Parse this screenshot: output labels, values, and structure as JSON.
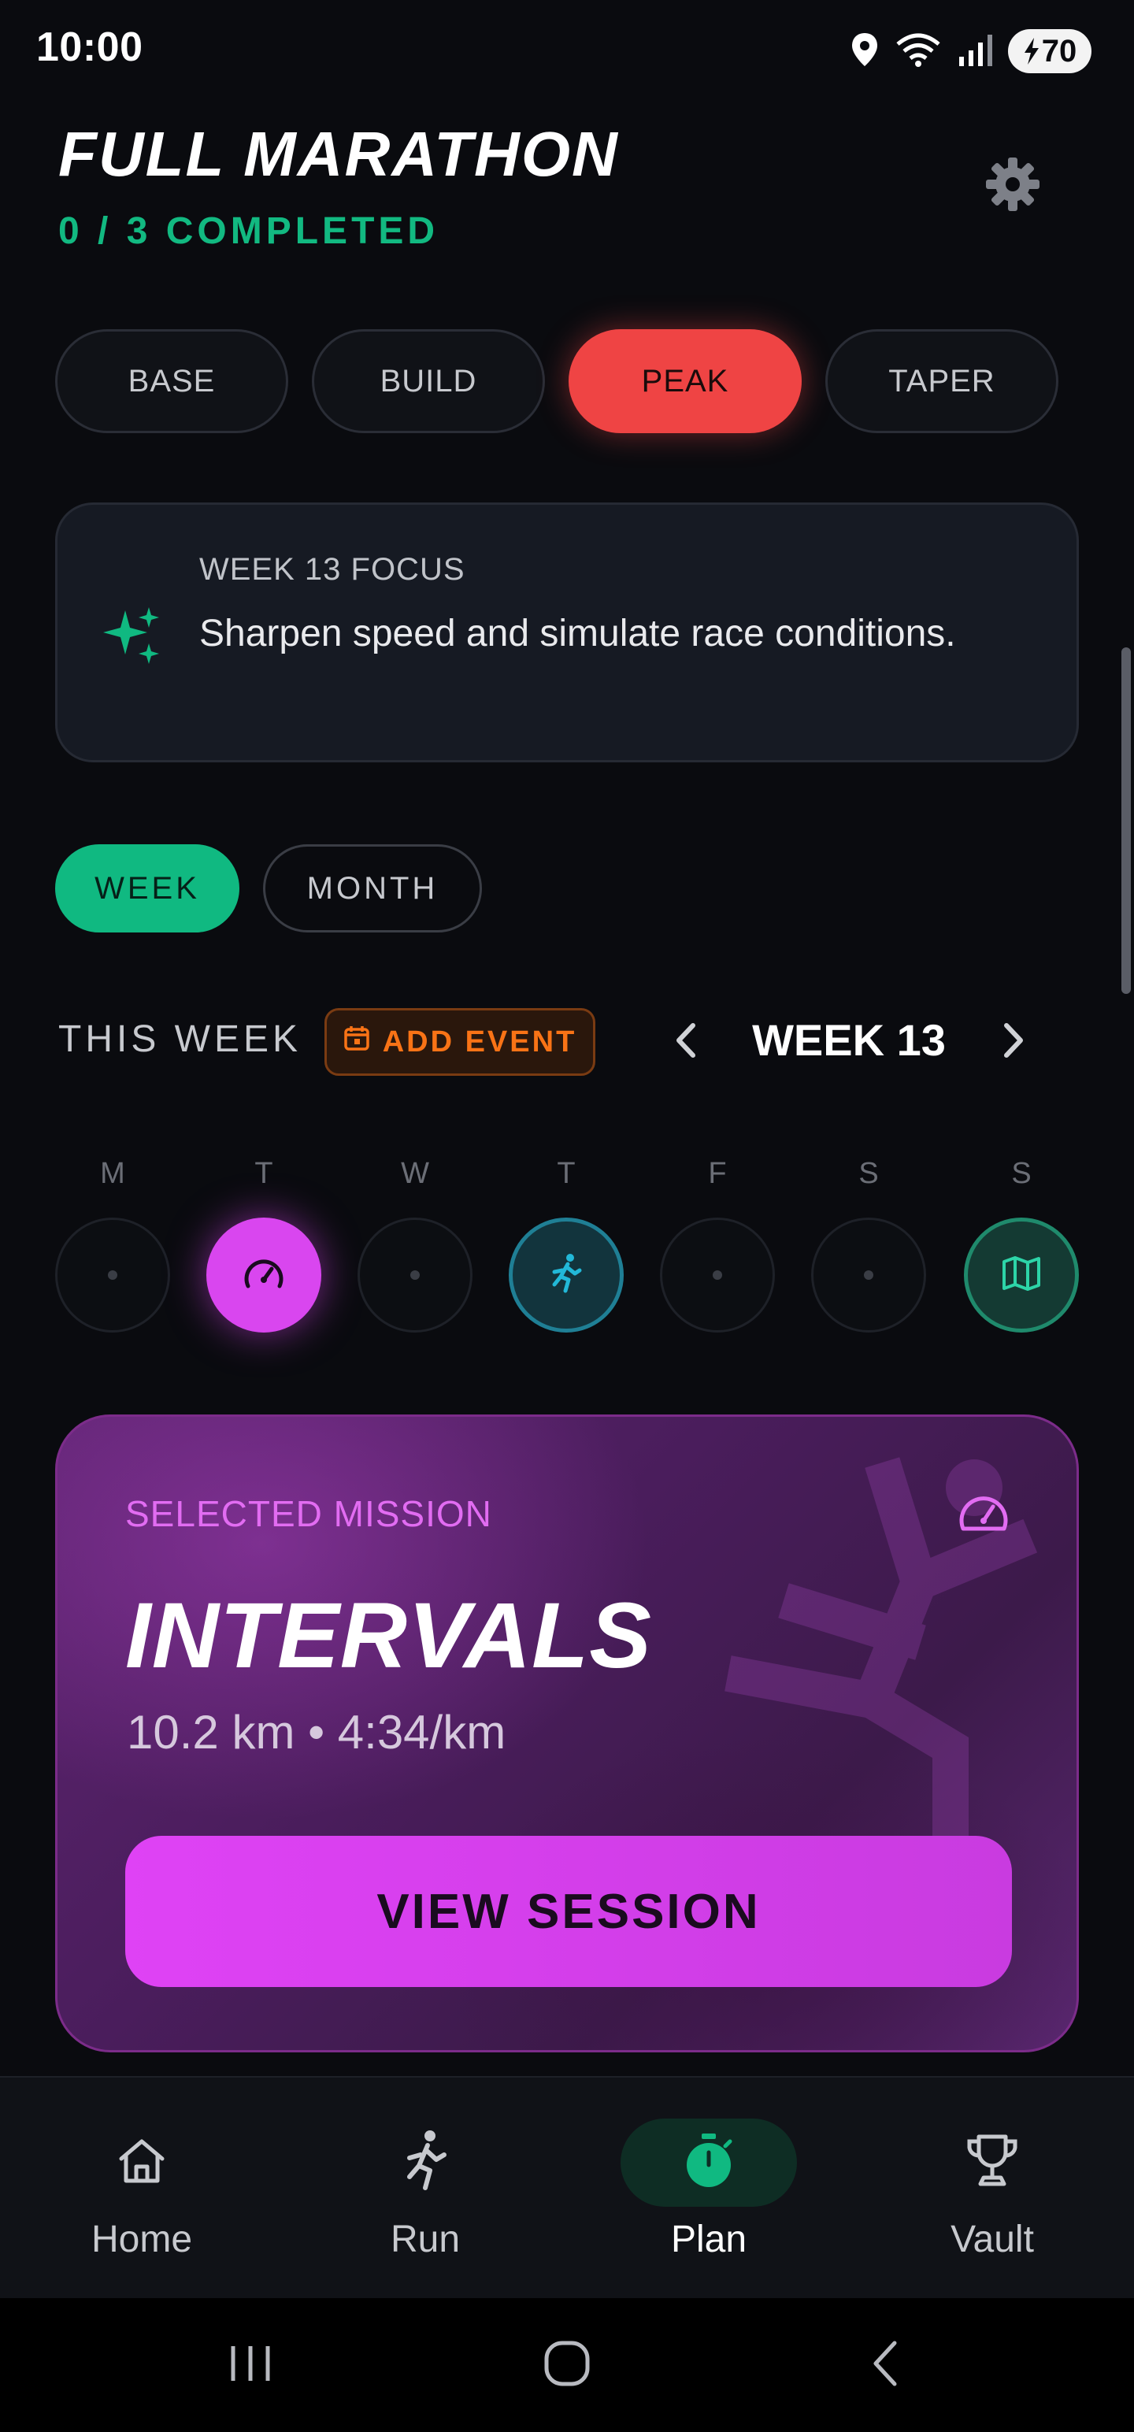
{
  "status_bar": {
    "time": "10:00",
    "battery": "70",
    "icons": [
      "location-icon",
      "wifi-icon",
      "signal-icon",
      "battery-icon"
    ]
  },
  "header": {
    "title": "FULL MARATHON",
    "completed": "0 / 3 COMPLETED",
    "settings_icon": "gear-icon"
  },
  "phases": {
    "active": "PEAK",
    "tabs": [
      {
        "label": "BASE"
      },
      {
        "label": "BUILD"
      },
      {
        "label": "PEAK"
      },
      {
        "label": "TAPER"
      }
    ]
  },
  "focus": {
    "label": "WEEK 13 FOCUS",
    "text": "Sharpen speed and simulate race conditions.",
    "icon": "sparkles-icon"
  },
  "view_toggle": {
    "active": "WEEK",
    "options": [
      {
        "label": "WEEK"
      },
      {
        "label": "MONTH"
      }
    ]
  },
  "week": {
    "label": "THIS WEEK",
    "add_event": "ADD EVENT",
    "current": "WEEK 13",
    "days": [
      {
        "letter": "M",
        "type": "rest"
      },
      {
        "letter": "T",
        "type": "intervals"
      },
      {
        "letter": "W",
        "type": "rest"
      },
      {
        "letter": "T",
        "type": "easy"
      },
      {
        "letter": "F",
        "type": "rest"
      },
      {
        "letter": "S",
        "type": "rest"
      },
      {
        "letter": "S",
        "type": "long"
      }
    ]
  },
  "mission": {
    "label": "SELECTED MISSION",
    "name": "INTERVALS",
    "detail": "10.2 km • 4:34/km",
    "button": "VIEW SESSION"
  },
  "bottom_nav": {
    "active": "Plan",
    "items": [
      {
        "label": "Home",
        "icon": "home-icon"
      },
      {
        "label": "Run",
        "icon": "runner-icon"
      },
      {
        "label": "Plan",
        "icon": "stopwatch-icon"
      },
      {
        "label": "Vault",
        "icon": "trophy-icon"
      }
    ]
  },
  "colors": {
    "accent_green": "#10b981",
    "peak_red": "#ef4444",
    "mission_magenta": "#d946ef",
    "event_orange": "#f97316"
  }
}
